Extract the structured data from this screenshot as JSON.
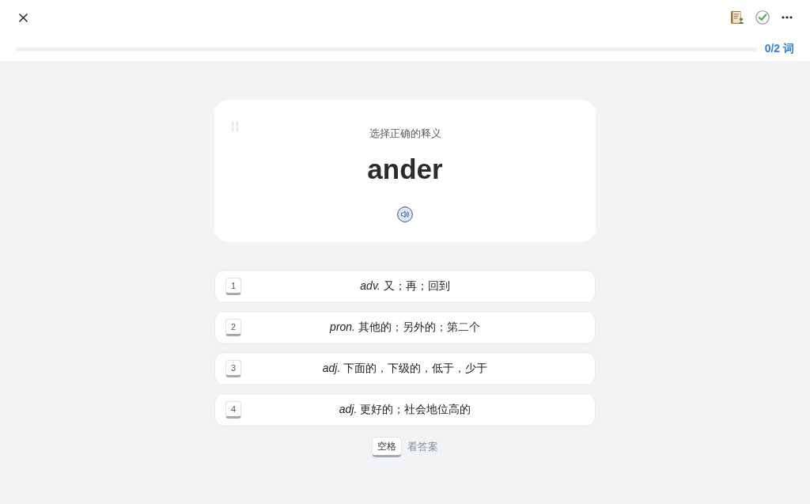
{
  "header": {
    "progress": {
      "level": 0,
      "label": "0/2 词"
    }
  },
  "card": {
    "prompt": "选择正确的释义",
    "word": "ander"
  },
  "options": [
    {
      "key": "1",
      "definition": "*adv.* 又；再；回到"
    },
    {
      "key": "2",
      "definition": "*pron.* 其他的；另外的；第二个"
    },
    {
      "key": "3",
      "definition": "*adj.* 下面的，下级的，低于，少于"
    },
    {
      "key": "4",
      "definition": "*adj.* 更好的；社会地位高的"
    }
  ],
  "hint": {
    "key": "空格",
    "label": "看答案"
  }
}
